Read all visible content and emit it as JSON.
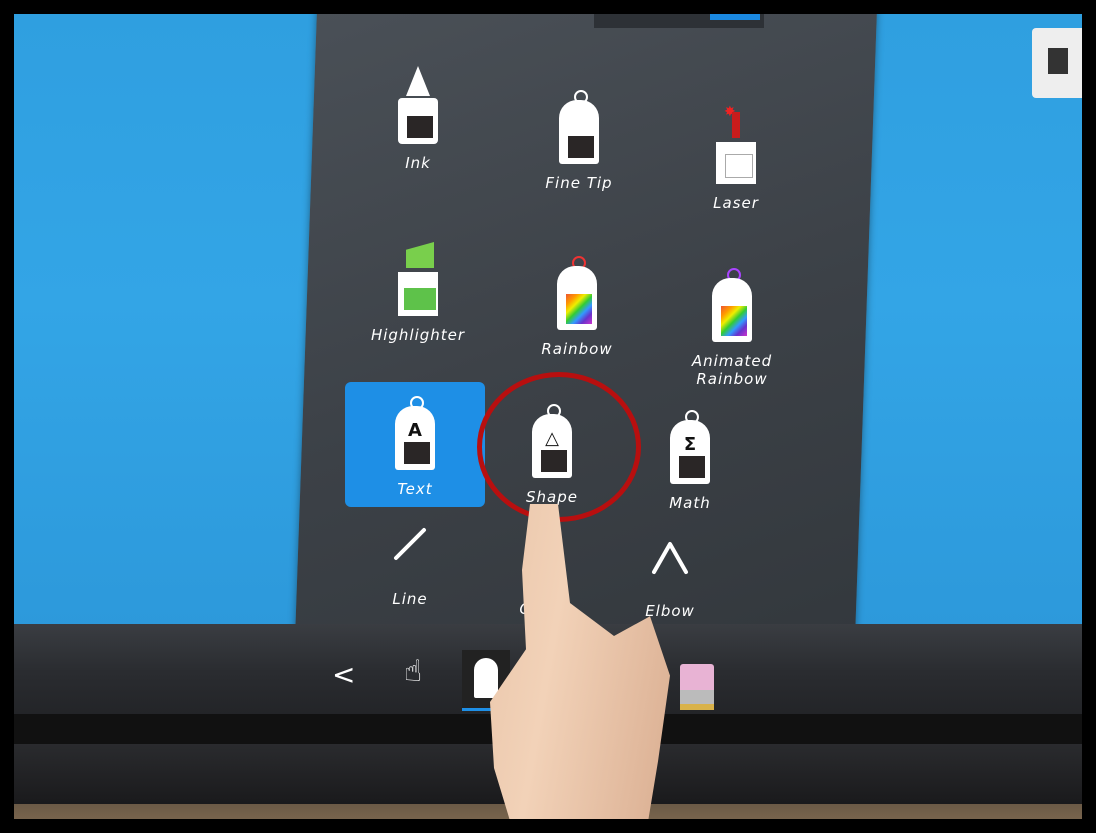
{
  "tools": [
    {
      "id": "ink",
      "label": "Ink"
    },
    {
      "id": "fine-tip",
      "label": "Fine Tip"
    },
    {
      "id": "laser",
      "label": "Laser"
    },
    {
      "id": "highlighter",
      "label": "Highlighter"
    },
    {
      "id": "rainbow",
      "label": "Rainbow"
    },
    {
      "id": "animated-rainbow",
      "label": "Animated\nRainbow"
    },
    {
      "id": "text",
      "label": "Text",
      "glyph": "A",
      "selected": true
    },
    {
      "id": "shape",
      "label": "Shape",
      "glyph": "△"
    },
    {
      "id": "math",
      "label": "Math",
      "glyph": "Σ"
    },
    {
      "id": "line",
      "label": "Line"
    },
    {
      "id": "curve",
      "label": "Curve"
    },
    {
      "id": "elbow",
      "label": "Elbow"
    }
  ],
  "taskbar": {
    "back_glyph": "<",
    "hand_glyph": "☝"
  },
  "colors": {
    "screen": "#2f9fe0",
    "panel": "#3c4147",
    "selected": "#1e8fe6",
    "highlight_circle": "#b80f0f"
  }
}
